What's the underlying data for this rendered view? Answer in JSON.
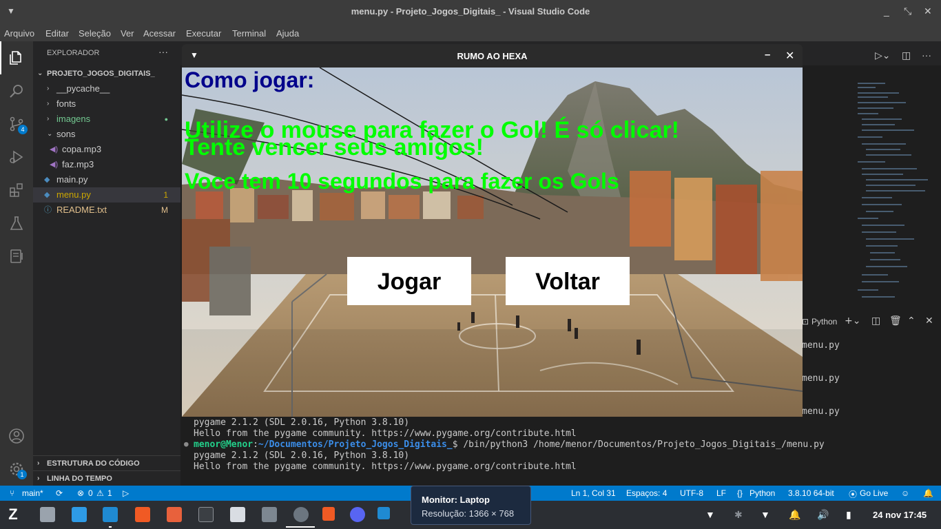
{
  "vscode": {
    "window_title": "menu.py - Projeto_Jogos_Digitais_ - Visual Studio Code",
    "menu": [
      "Arquivo",
      "Editar",
      "Seleção",
      "Ver",
      "Acessar",
      "Executar",
      "Terminal",
      "Ajuda"
    ],
    "activity_badges": {
      "scm": "4",
      "settings": "1"
    },
    "explorer": {
      "header": "EXPLORADOR",
      "more": "···",
      "project": "PROJETO_JOGOS_DIGITAIS_",
      "items": [
        {
          "label": "__pycache__",
          "status": ""
        },
        {
          "label": "fonts",
          "status": ""
        },
        {
          "label": "imagens",
          "status": "●"
        },
        {
          "label": "sons",
          "status": ""
        },
        {
          "label": "copa.mp3",
          "status": ""
        },
        {
          "label": "faz.mp3",
          "status": ""
        },
        {
          "label": "main.py",
          "status": ""
        },
        {
          "label": "menu.py",
          "status": "1"
        },
        {
          "label": "README.txt",
          "status": "M"
        }
      ],
      "outline": "ESTRUTURA DO CÓDIGO",
      "timeline": "LINHA DO TEMPO"
    },
    "terminal": {
      "lines": [
        "pygame 2.1.2 (SDL 2.0.16, Python 3.8.10)",
        "Hello from the pygame community. https://www.pygame.org/contribute.html",
        "pygame 2.1.2 (SDL 2.0.16, Python 3.8.10)",
        "Hello from the pygame community. https://www.pygame.org/contribute.html"
      ],
      "prompt_user": "menor@Menor",
      "prompt_sep": ":",
      "prompt_path": "~/Documentos/Projeto_Jogos_Digitais_",
      "prompt_cmd": "$ /bin/python3 /home/menor/Documentos/Projeto_Jogos_Digitais_/menu.py",
      "shell_label": "Python",
      "side_entries": [
        "menu.py",
        "menu.py",
        "menu.py"
      ]
    },
    "status": {
      "branch": "main*",
      "errors": "0",
      "warnings": "1",
      "position": "Ln 1, Col 31",
      "spaces": "Espaços: 4",
      "encoding": "UTF-8",
      "eol": "LF",
      "language": "Python",
      "interpreter": "3.8.10 64-bit",
      "golive": "Go Live"
    }
  },
  "game": {
    "window_title": "RUMO AO HEXA",
    "heading": "Como jogar:",
    "lines": [
      "Utilize o mouse para fazer o Gol! É só clicar!",
      "Tente vencer seus amigos!",
      "Voce tem 10 segundos para fazer os Gols"
    ],
    "play_button": "Jogar",
    "back_button": "Voltar",
    "colors": {
      "heading": "#00008b",
      "text": "#00ff00"
    }
  },
  "tooltip": {
    "monitor": "Monitor: Laptop",
    "resolution": "Resolução: 1366 × 768"
  },
  "taskbar": {
    "date": "24 nov 17:45"
  }
}
